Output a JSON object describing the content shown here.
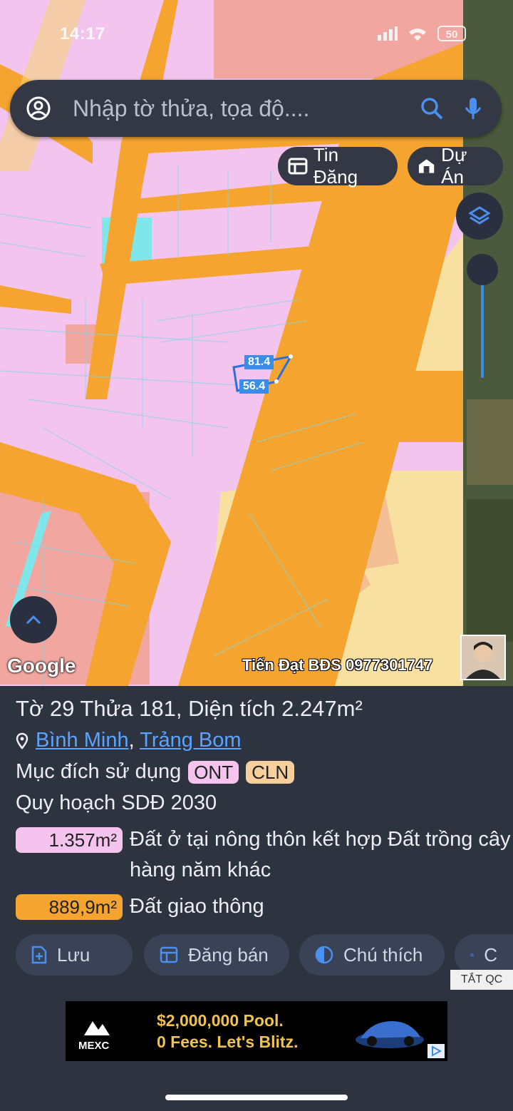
{
  "status_bar": {
    "time": "14:17",
    "battery": "50"
  },
  "search": {
    "placeholder": "Nhập tờ thửa, tọa độ...."
  },
  "chips": {
    "listings": "Tin Đăng",
    "projects": "Dự Án"
  },
  "map": {
    "attribution": "Google",
    "watermark": "Tiến Đạt BĐS 0977301747",
    "measure_top": "81.4",
    "measure_bottom": "56.4"
  },
  "parcel": {
    "title": "Tờ 29 Thửa 181, Diện tích 2.247m²",
    "commune": "Bình Minh",
    "district": "Trảng Bom",
    "separator": ",",
    "purpose_label": "Mục đích sử dụng",
    "purpose_tags": [
      "ONT",
      "CLN"
    ],
    "plan_label": "Quy hoạch SDĐ 2030",
    "plan_items": [
      {
        "area": "1.357m²",
        "description": "Đất ở tại nông thôn kết hợp Đất trồng cây hàng năm khác",
        "color": "#f4c4ee"
      },
      {
        "area": "889,9m²",
        "description": "Đất giao thông",
        "color": "#f5a52f"
      }
    ]
  },
  "actions": {
    "save": "Lưu",
    "sell": "Đăng bán",
    "legend": "Chú thích",
    "camera": "C"
  },
  "ad": {
    "close_label": "TẮT QC",
    "line1": "$2,000,000 Pool.",
    "line2": "0 Fees. Let's Blitz.",
    "brand": "MEXC"
  },
  "colors": {
    "residential": "#f3c4ee",
    "road": "#f5a52f",
    "perennial": "#f7e0a0",
    "accent": "#3a8de6",
    "panel": "#2e3340"
  }
}
